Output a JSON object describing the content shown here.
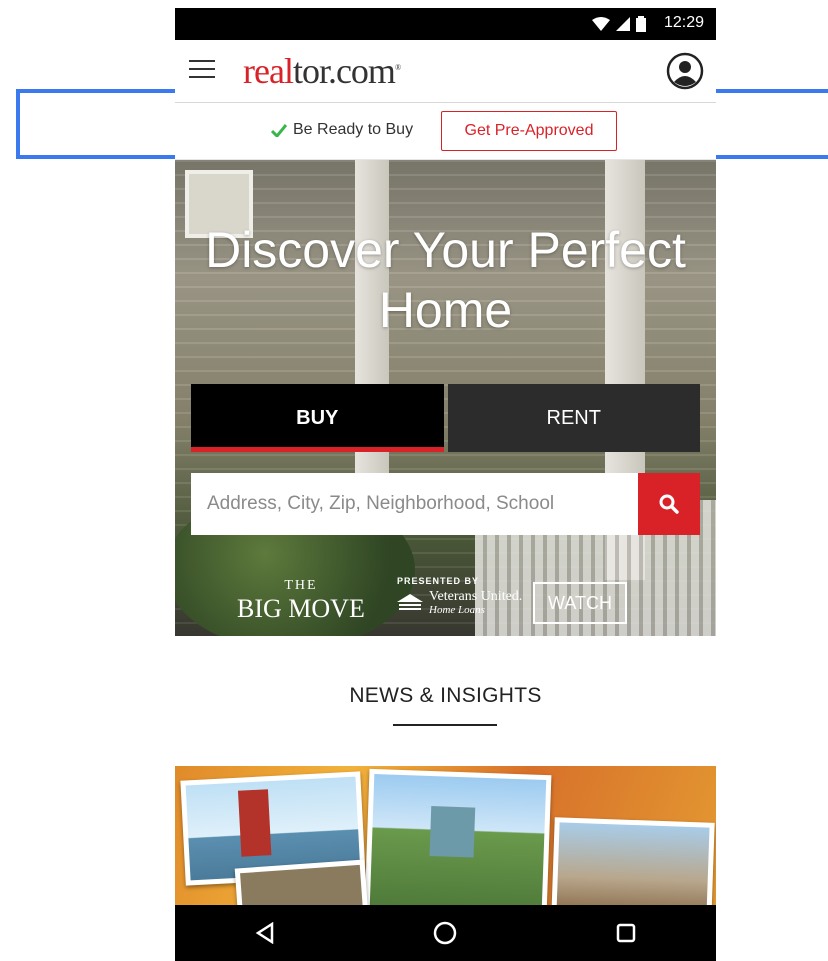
{
  "status_bar": {
    "time": "12:29",
    "icons": [
      "wifi-icon",
      "signal-icon",
      "battery-icon"
    ]
  },
  "header": {
    "logo_red": "real",
    "logo_rest": "tor.com",
    "logo_mark": "®"
  },
  "promo": {
    "ready_text": "Be Ready to Buy",
    "cta_label": "Get Pre-Approved"
  },
  "hero": {
    "headline": "Discover Your Perfect Home",
    "tabs": [
      {
        "label": "BUY",
        "selected": true
      },
      {
        "label": "RENT",
        "selected": false
      }
    ],
    "search_placeholder": "Address, City, Zip, Neighborhood, School",
    "big_move": {
      "the": "THE",
      "title": "BIG MOVE",
      "presented_by": "PRESENTED BY",
      "sponsor": "Veterans United.",
      "sponsor_sub": "Home Loans"
    },
    "watch_label": "WATCH"
  },
  "news": {
    "title": "NEWS & INSIGHTS"
  },
  "colors": {
    "brand_red": "#d92228",
    "highlight_blue": "#3a79ee"
  }
}
